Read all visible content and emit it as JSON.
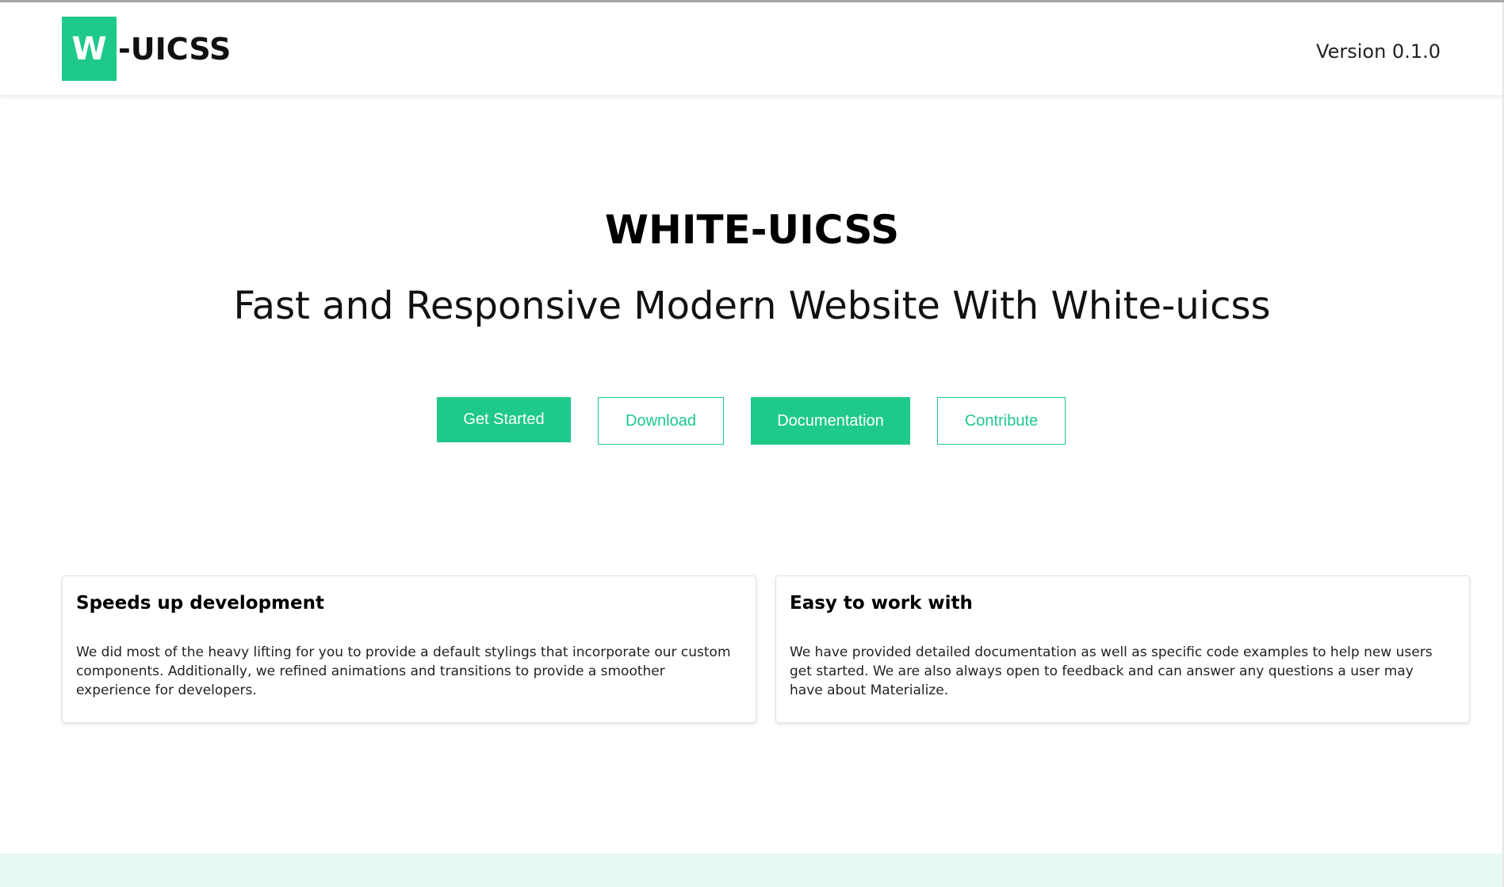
{
  "colors": {
    "accent": "#1ec98a",
    "footer": "#e8f8f2"
  },
  "header": {
    "logo_letter": "W",
    "logo_suffix": "-UICSS",
    "version": "Version 0.1.0"
  },
  "hero": {
    "title": "WHITE-UICSS",
    "subtitle": "Fast and Responsive Modern Website With White-uicss"
  },
  "buttons": {
    "get_started": "Get Started",
    "download": "Download",
    "documentation": "Documentation",
    "contribute": "Contribute"
  },
  "cards": [
    {
      "title": "Speeds up development",
      "body": "We did most of the heavy lifting for you to provide a default stylings that incorporate our custom components. Additionally, we refined animations and transitions to provide a smoother experience for developers."
    },
    {
      "title": "Easy to work with",
      "body": "We have provided detailed documentation as well as specific code examples to help new users get started. We are also always open to feedback and can answer any questions a user may have about Materialize."
    }
  ]
}
